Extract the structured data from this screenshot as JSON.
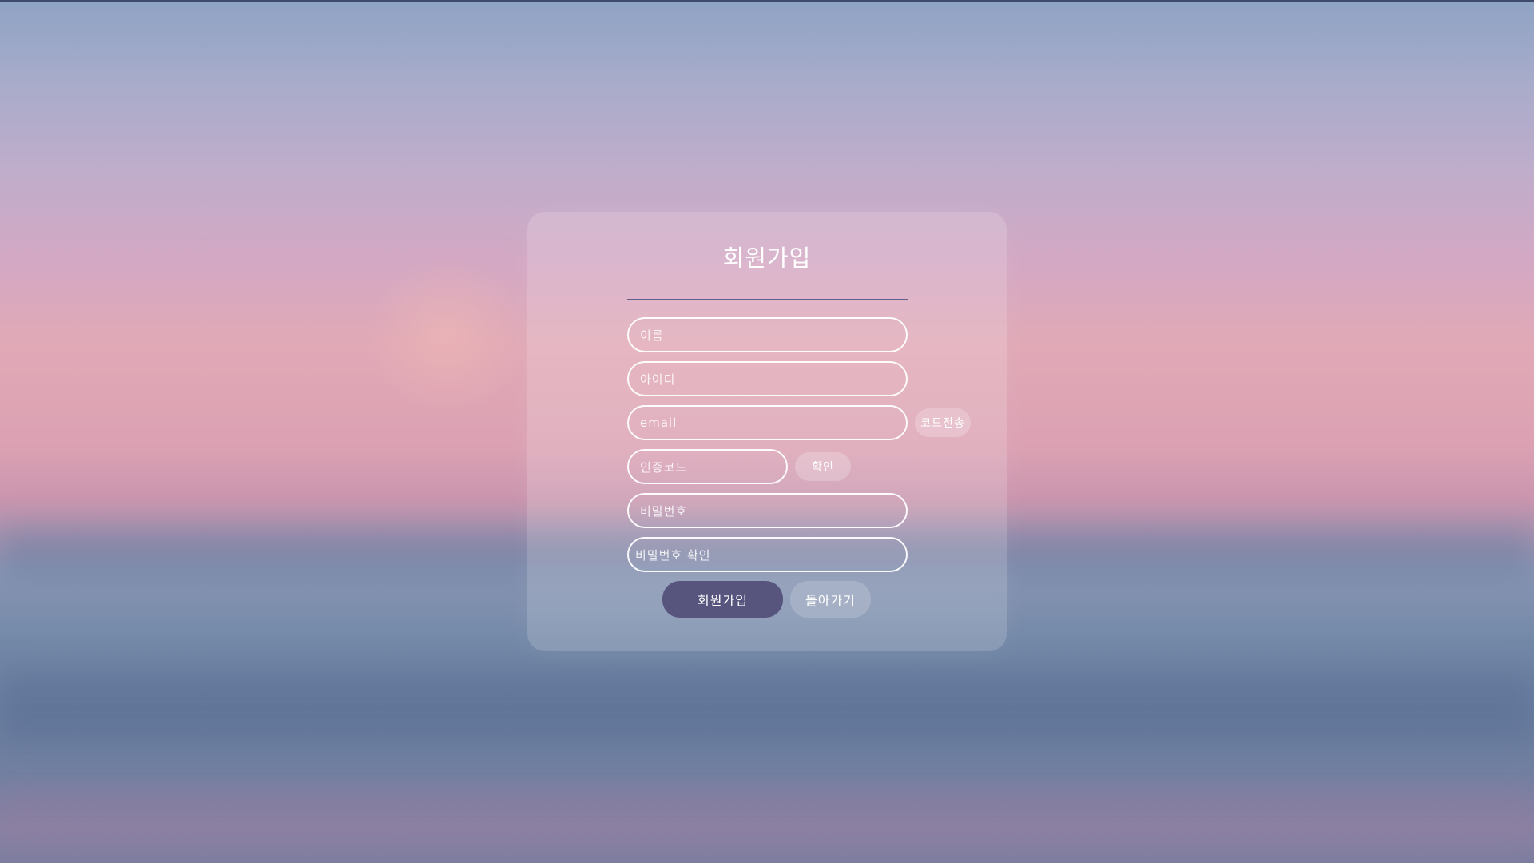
{
  "title": "회원가입",
  "fields": {
    "name_placeholder": "이름",
    "id_placeholder": "아이디",
    "email_placeholder": "email",
    "code_placeholder": "인증코드",
    "password_placeholder": "비밀번호",
    "password_confirm_placeholder": "비밀번호 확인"
  },
  "buttons": {
    "send_code": "코드전송",
    "confirm": "확인",
    "signup": "회원가입",
    "back": "돌아가기"
  },
  "colors": {
    "primary_button": "#57557e",
    "divider": "#5e5f8a",
    "text": "#ffffff"
  }
}
